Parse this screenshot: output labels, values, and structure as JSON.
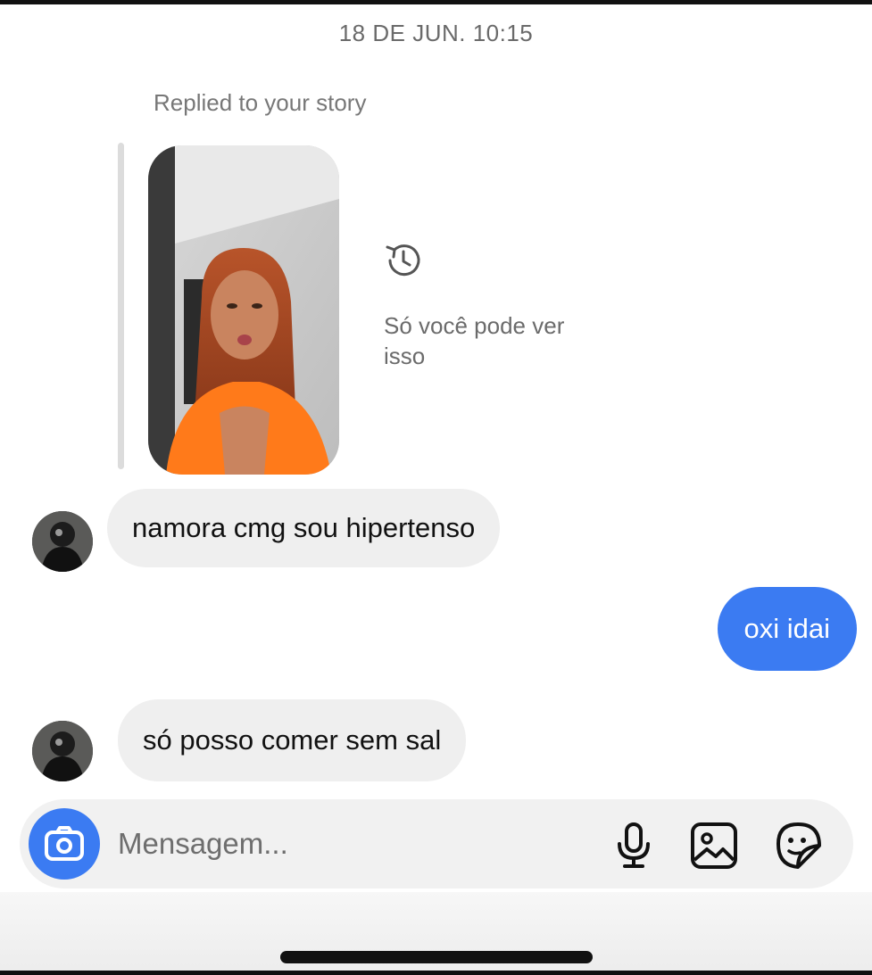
{
  "thread": {
    "date_separator": "18 DE JUN. 10:15",
    "story_reply": {
      "label": "Replied to your story",
      "notice": "Só você pode ver isso",
      "notice_icon": "history-icon"
    },
    "messages": [
      {
        "direction": "incoming",
        "text": "namora cmg sou hipertenso"
      },
      {
        "direction": "outgoing",
        "text": "oxi idai"
      },
      {
        "direction": "incoming",
        "text": "só posso comer sem sal"
      }
    ]
  },
  "composer": {
    "placeholder": "Mensagem...",
    "icons": [
      "camera-icon",
      "microphone-icon",
      "gallery-icon",
      "sticker-icon"
    ]
  },
  "colors": {
    "accent": "#3b7bf2",
    "incoming_bubble": "#efefef",
    "muted_text": "#6b6b6b"
  }
}
